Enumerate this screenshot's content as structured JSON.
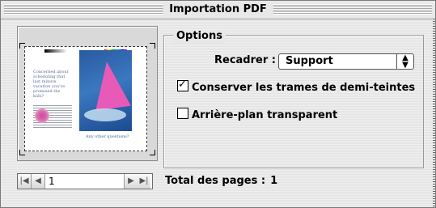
{
  "window": {
    "title": "Importation PDF"
  },
  "options": {
    "group_label": "Options",
    "crop_label": "Recadrer :",
    "crop_value": "Support",
    "keep_halftone_label": "Conserver les trames de demi-teintes",
    "keep_halftone_checked": true,
    "transparent_bg_label": "Arrière-plan transparent",
    "transparent_bg_checked": false
  },
  "preview": {
    "text_excerpt": "Concerned about scheduling that last minute vacation you've promised the kids?",
    "caption": "Any other questions?"
  },
  "navigation": {
    "page_value": "1",
    "first_icon": "first-page-icon",
    "prev_icon": "prev-page-icon",
    "next_icon": "next-page-icon",
    "last_icon": "last-page-icon"
  },
  "footer": {
    "total_label": "Total des pages :",
    "total_value": "1"
  }
}
